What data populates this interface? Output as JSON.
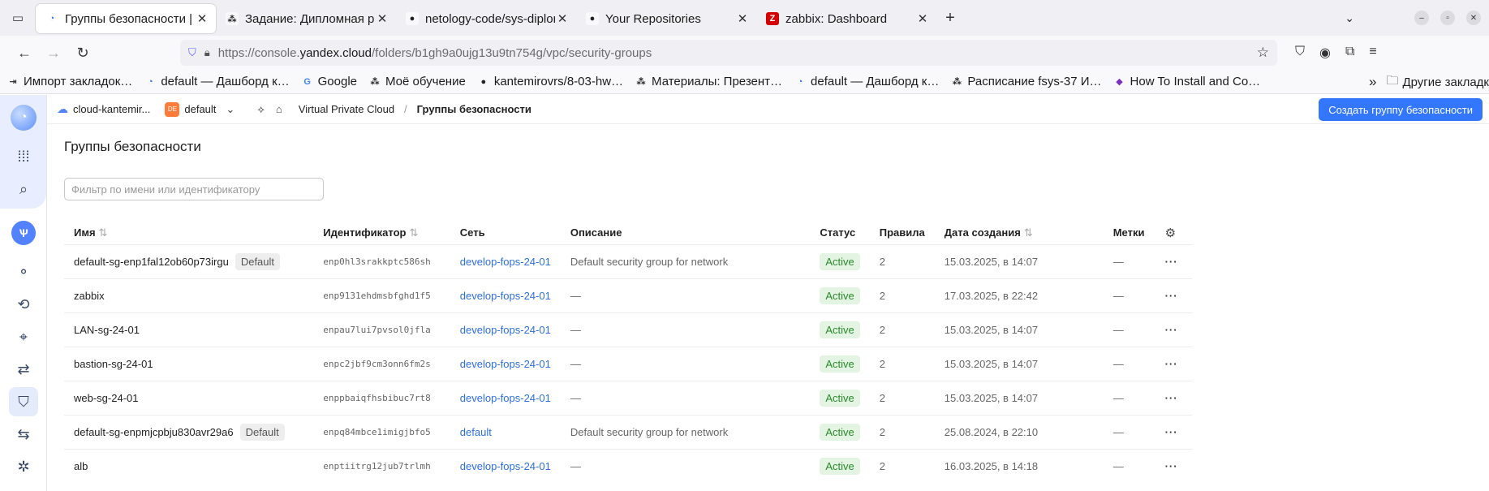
{
  "browser": {
    "tabs": [
      {
        "title": "Группы безопасности | Y",
        "favicon": "yandex-cloud",
        "active": true
      },
      {
        "title": "Задание: Дипломная ра",
        "favicon": "netology",
        "active": false
      },
      {
        "title": "netology-code/sys-diplom",
        "favicon": "github",
        "active": false
      },
      {
        "title": "Your Repositories",
        "favicon": "github",
        "active": false
      },
      {
        "title": "zabbix: Dashboard",
        "favicon": "zabbix",
        "active": false
      }
    ],
    "url_prefix": "https://console.",
    "url_domain": "yandex.cloud",
    "url_path": "/folders/b1gh9a0ujg13u9tn754g/vpc/security-groups",
    "bookmarks": [
      {
        "label": "Импорт закладок…",
        "icon": "import-icon"
      },
      {
        "label": "default — Дашборд к…",
        "icon": "yandex-cloud"
      },
      {
        "label": "Google",
        "icon": "google"
      },
      {
        "label": "Моё обучение",
        "icon": "netology"
      },
      {
        "label": "kantemirovrs/8-03-hw…",
        "icon": "github"
      },
      {
        "label": "Материалы: Презент…",
        "icon": "netology"
      },
      {
        "label": "default — Дашборд к…",
        "icon": "yandex-cloud"
      },
      {
        "label": "Расписание fsys-37 И…",
        "icon": "netology"
      },
      {
        "label": "How To Install and Co…",
        "icon": "digitalocean"
      }
    ],
    "bookmarks_overflow": "»",
    "other_bookmarks": "Другие закладк"
  },
  "topstrip": {
    "cloud": "cloud-kantemir...",
    "folder_badge": "DE",
    "folder": "default",
    "service": "Virtual Private Cloud",
    "separator": "/",
    "current": "Группы безопасности",
    "create_button": "Создать группу безопасности"
  },
  "page": {
    "title": "Группы безопасности",
    "filter_placeholder": "Фильтр по имени или идентификатору"
  },
  "table": {
    "columns": [
      "Имя",
      "Идентификатор",
      "Сеть",
      "Описание",
      "Статус",
      "Правила",
      "Дата создания",
      "Метки"
    ],
    "rows": [
      {
        "name": "default-sg-enp1fal12ob60p73irgu",
        "tag": "Default",
        "id": "enp0hl3srakkptc586sh",
        "network": "develop-fops-24-01",
        "description": "Default security group for network",
        "status": "Active",
        "rules": "2",
        "created": "15.03.2025, в 14:07",
        "labels": "—"
      },
      {
        "name": "zabbix",
        "tag": "",
        "id": "enp9131ehdmsbfghd1f5",
        "network": "develop-fops-24-01",
        "description": "—",
        "status": "Active",
        "rules": "2",
        "created": "17.03.2025, в 22:42",
        "labels": "—"
      },
      {
        "name": "LAN-sg-24-01",
        "tag": "",
        "id": "enpau7lui7pvsol0jfla",
        "network": "develop-fops-24-01",
        "description": "—",
        "status": "Active",
        "rules": "2",
        "created": "15.03.2025, в 14:07",
        "labels": "—"
      },
      {
        "name": "bastion-sg-24-01",
        "tag": "",
        "id": "enpc2jbf9cm3onn6fm2s",
        "network": "develop-fops-24-01",
        "description": "—",
        "status": "Active",
        "rules": "2",
        "created": "15.03.2025, в 14:07",
        "labels": "—"
      },
      {
        "name": "web-sg-24-01",
        "tag": "",
        "id": "enppbaiqfhsbibuc7rt8",
        "network": "develop-fops-24-01",
        "description": "—",
        "status": "Active",
        "rules": "2",
        "created": "15.03.2025, в 14:07",
        "labels": "—"
      },
      {
        "name": "default-sg-enpmjcpbju830avr29a6",
        "tag": "Default",
        "id": "enpq84mbce1imigjbfo5",
        "network": "default",
        "description": "Default security group for network",
        "status": "Active",
        "rules": "2",
        "created": "25.08.2024, в 22:10",
        "labels": "—"
      },
      {
        "name": "alb",
        "tag": "",
        "id": "enptiitrg12jub7trlmh",
        "network": "develop-fops-24-01",
        "description": "—",
        "status": "Active",
        "rules": "2",
        "created": "16.03.2025, в 14:18",
        "labels": "—"
      }
    ]
  },
  "colors": {
    "accent": "#3377ff",
    "status_active_bg": "#e3f4e3",
    "status_active_fg": "#2a8a2a",
    "link": "#2d6fe0"
  }
}
